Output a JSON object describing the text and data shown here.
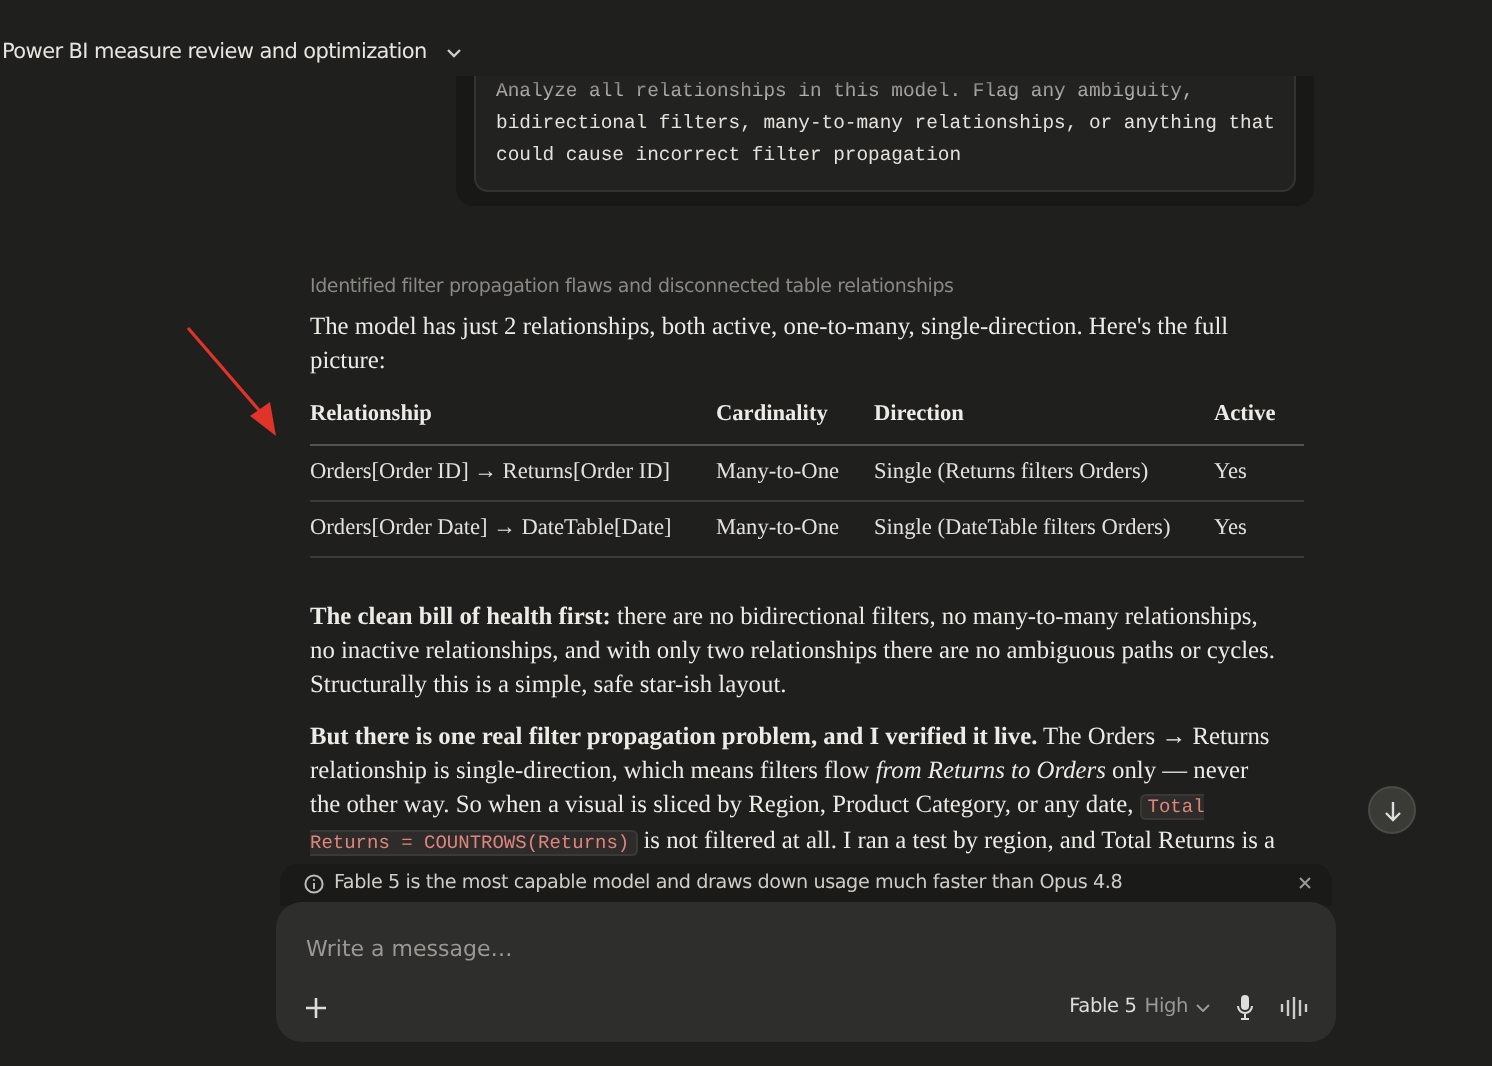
{
  "header": {
    "title": "Power BI measure review and optimization"
  },
  "prompt": {
    "text": "Analyze all relationships in this model. Flag any ambiguity, bidirectional filters, many-to-many relationships, or anything that could cause incorrect filter propagation"
  },
  "thinking_summary": "Identified filter propagation flaws and disconnected table relationships",
  "intro": "The model has just 2 relationships, both active, one-to-many, single-direction. Here's the full picture:",
  "table": {
    "columns": [
      "Relationship",
      "Cardinality",
      "Direction",
      "Active"
    ],
    "rows": [
      [
        "Orders[Order ID] → Returns[Order ID]",
        "Many-to-One",
        "Single (Returns filters Orders)",
        "Yes"
      ],
      [
        "Orders[Order Date] → DateTable[Date]",
        "Many-to-One",
        "Single (DateTable filters Orders)",
        "Yes"
      ]
    ]
  },
  "paragraphs": [
    [
      {
        "kind": "text",
        "text": "**The clean bill of health first:** there are no bidirectional filters, no many-to-many relationships, no inactive relationships, and with only two relationships there are no ambiguous paths or cycles. Structurally this is a simple, safe star-ish layout."
      }
    ],
    [
      {
        "kind": "text",
        "text": "**But there is one real filter propagation problem, and I verified it live.** The Orders → Returns relationship is single-direction, which means filters flow *from Returns to Orders* only — never the other way. So when a visual is sliced by Region, Product Category, or any date, "
      },
      {
        "kind": "code",
        "text": "Total Returns = COUNTROWS(Returns)"
      },
      {
        "kind": "text",
        "text": " is not filtered at all. I ran a test by region, and Total Returns is a"
      }
    ]
  ],
  "notice": {
    "text": "Fable 5 is the most capable model and draws down usage much faster than Opus 4.8"
  },
  "composer": {
    "placeholder": "Write a message…",
    "model": "Fable 5",
    "effort": "High"
  }
}
